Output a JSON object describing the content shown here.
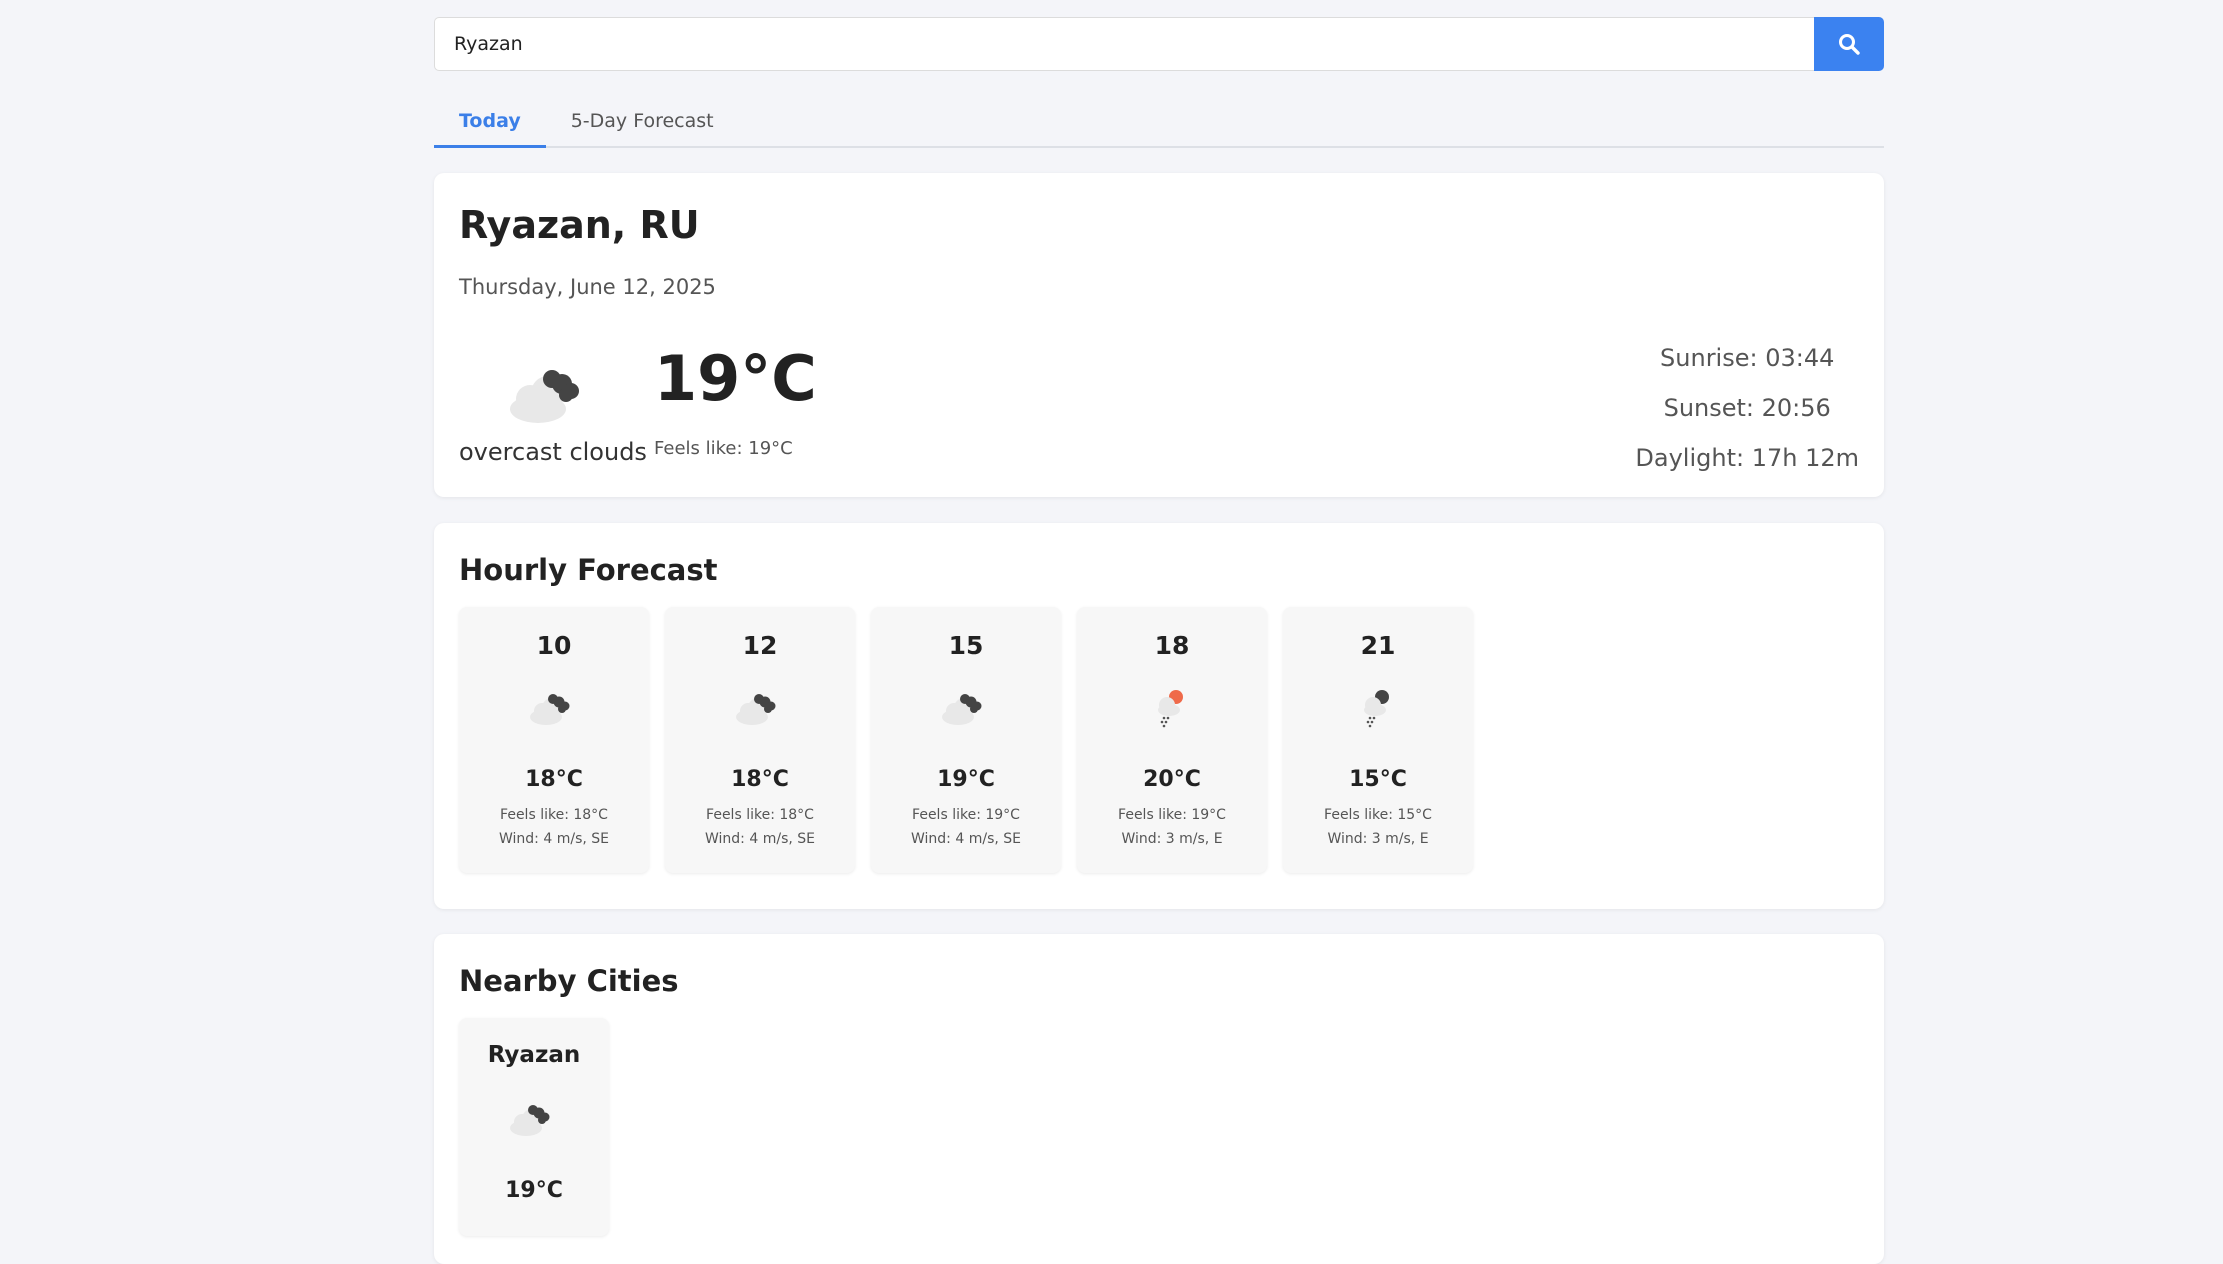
{
  "search": {
    "value": "Ryazan",
    "button_icon": "search-icon"
  },
  "tabs": [
    {
      "label": "Today",
      "active": true
    },
    {
      "label": "5-Day Forecast",
      "active": false
    }
  ],
  "current": {
    "city": "Ryazan, RU",
    "date": "Thursday, June 12, 2025",
    "condition": "overcast clouds",
    "condition_icon": "overcast-clouds-icon",
    "temperature": "19°C",
    "feels_like": "Feels like: 19°C",
    "sunrise": "Sunrise: 03:44",
    "sunset": "Sunset: 20:56",
    "daylight": "Daylight: 17h 12m"
  },
  "hourly": {
    "title": "Hourly Forecast",
    "items": [
      {
        "time": "10",
        "icon": "overcast-clouds-icon",
        "temp": "18°C",
        "feels": "Feels like: 18°C",
        "wind": "Wind: 4 m/s, SE"
      },
      {
        "time": "12",
        "icon": "overcast-clouds-icon",
        "temp": "18°C",
        "feels": "Feels like: 18°C",
        "wind": "Wind: 4 m/s, SE"
      },
      {
        "time": "15",
        "icon": "overcast-clouds-icon",
        "temp": "19°C",
        "feels": "Feels like: 19°C",
        "wind": "Wind: 4 m/s, SE"
      },
      {
        "time": "18",
        "icon": "sun-rain-icon",
        "temp": "20°C",
        "feels": "Feels like: 19°C",
        "wind": "Wind: 3 m/s, E"
      },
      {
        "time": "21",
        "icon": "cloud-rain-icon",
        "temp": "15°C",
        "feels": "Feels like: 15°C",
        "wind": "Wind: 3 m/s, E"
      }
    ]
  },
  "nearby": {
    "title": "Nearby Cities",
    "items": [
      {
        "name": "Ryazan",
        "icon": "overcast-clouds-icon",
        "temp": "19°C"
      }
    ]
  },
  "colors": {
    "accent": "#3b82f0",
    "background": "#f4f5f9",
    "sun": "#ef6a4a"
  }
}
